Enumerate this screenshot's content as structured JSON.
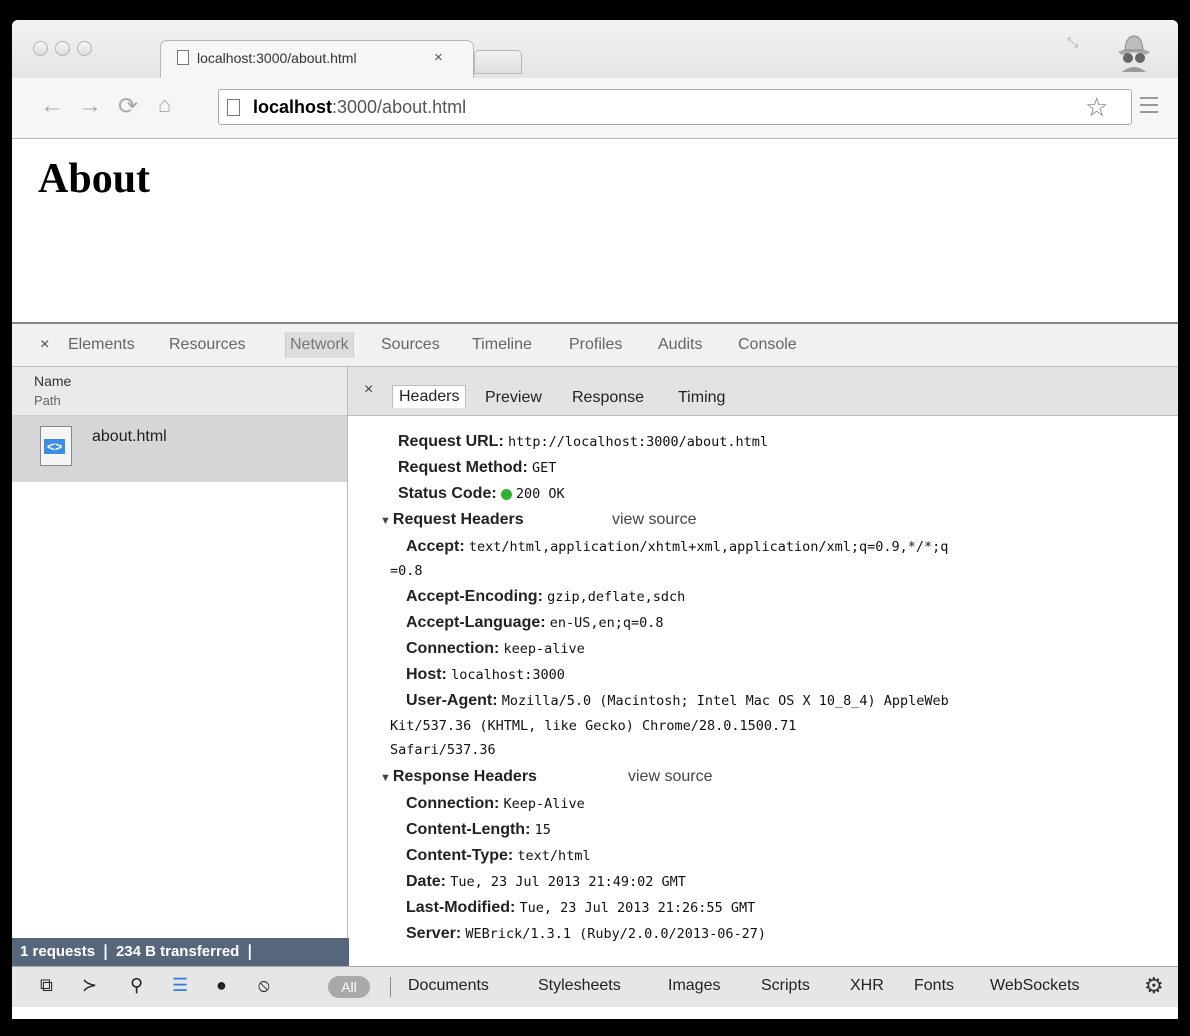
{
  "browser": {
    "tab": {
      "title": "localhost:3000/about.html",
      "close": "×"
    },
    "url_bold": "localhost",
    "url_rest": ":3000/about.html"
  },
  "page": {
    "heading": "About"
  },
  "devtools": {
    "close": "×",
    "tabs": [
      "Elements",
      "Resources",
      "Network",
      "Sources",
      "Timeline",
      "Profiles",
      "Audits",
      "Console"
    ],
    "active_tab": "Network",
    "list": {
      "col_name": "Name",
      "col_path": "Path",
      "file_icon_text": "<>",
      "file": "about.html",
      "summary": "1 requests  ❘  234 B transferred  ❘"
    },
    "detail": {
      "close": "×",
      "tabs": [
        "Headers",
        "Preview",
        "Response",
        "Timing"
      ],
      "general": [
        {
          "k": "Request URL:",
          "v": "http://localhost:3000/about.html"
        },
        {
          "k": "Request Method:",
          "v": "GET"
        },
        {
          "k": "Status Code:",
          "v": "200 OK"
        }
      ],
      "request_title": "Request Headers",
      "response_title": "Response Headers",
      "view_source": "view source",
      "request": [
        {
          "k": "Accept:",
          "v": "text/html,application/xhtml+xml,application/xml;q=0.9,*/*;q"
        },
        {
          "k": "",
          "v": "=0.8"
        },
        {
          "k": "Accept-Encoding:",
          "v": "gzip,deflate,sdch"
        },
        {
          "k": "Accept-Language:",
          "v": "en-US,en;q=0.8"
        },
        {
          "k": "Connection:",
          "v": "keep-alive"
        },
        {
          "k": "Host:",
          "v": "localhost:3000"
        },
        {
          "k": "User-Agent:",
          "v": "Mozilla/5.0 (Macintosh; Intel Mac OS X 10_8_4) AppleWeb"
        },
        {
          "k": "",
          "v": "Kit/537.36 (KHTML, like Gecko) Chrome/28.0.1500.71"
        },
        {
          "k": "",
          "v": "Safari/537.36"
        }
      ],
      "response": [
        {
          "k": "Connection:",
          "v": "Keep-Alive"
        },
        {
          "k": "Content-Length:",
          "v": "15"
        },
        {
          "k": "Content-Type:",
          "v": "text/html"
        },
        {
          "k": "Date:",
          "v": "Tue, 23 Jul 2013 21:49:02 GMT"
        },
        {
          "k": "Last-Modified:",
          "v": "Tue, 23 Jul 2013 21:26:55 GMT"
        },
        {
          "k": "Server:",
          "v": "WEBrick/1.3.1 (Ruby/2.0.0/2013-06-27)"
        }
      ]
    },
    "filter_all": "All",
    "filters": [
      "Documents",
      "Stylesheets",
      "Images",
      "Scripts",
      "XHR",
      "Fonts",
      "WebSockets"
    ],
    "colors": {
      "summary_bg": "#56677c",
      "status_green": "#2bb52b"
    }
  }
}
